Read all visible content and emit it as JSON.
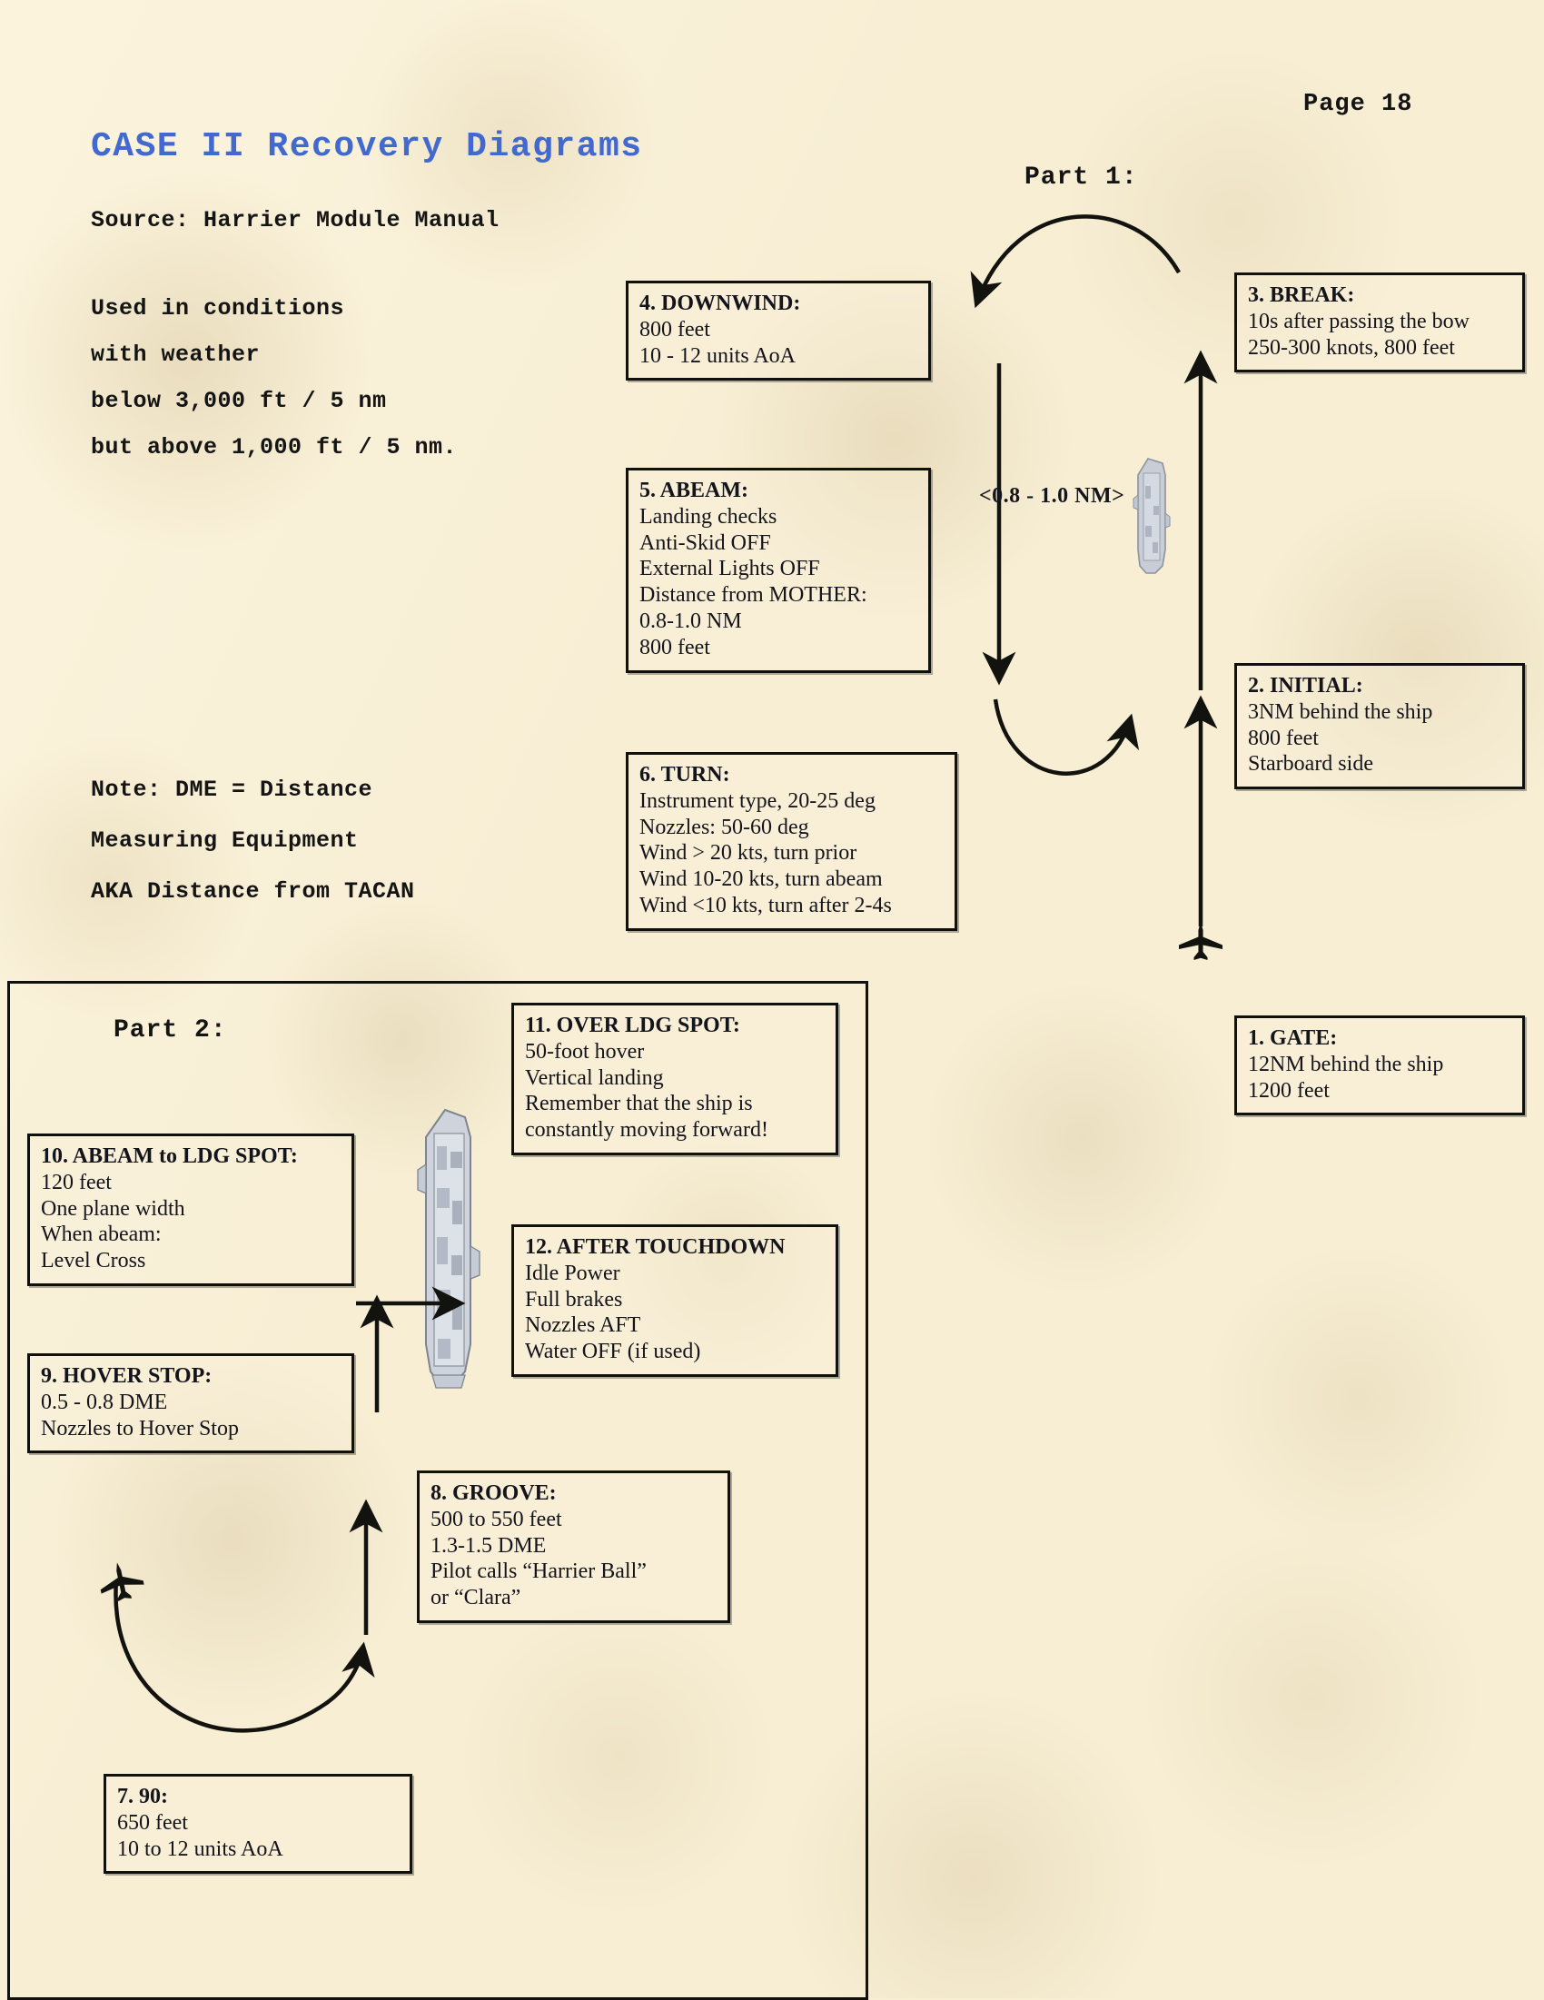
{
  "page": {
    "number_label": "Page 18",
    "title": "CASE II Recovery Diagrams",
    "source": "Source: Harrier Module Manual",
    "accent_color": "#4169cf",
    "background_color": "#f7eed4",
    "border_color": "#10100e"
  },
  "notes": {
    "conditions": [
      "Used in conditions",
      "with weather",
      "below 3,000 ft / 5 nm",
      "but above 1,000 ft / 5 nm."
    ],
    "dme": [
      "Note: DME = Distance",
      "Measuring Equipment",
      "AKA Distance from TACAN"
    ]
  },
  "sections": {
    "part1_label": "Part 1:",
    "part2_label": "Part 2:"
  },
  "annotations": {
    "distance_label": "<0.8 - 1.0 NM>"
  },
  "boxes": [
    {
      "id": "gate",
      "title": "1. GATE:",
      "lines": [
        "12NM behind the ship",
        "1200 feet"
      ]
    },
    {
      "id": "initial",
      "title": "2. INITIAL:",
      "lines": [
        "3NM behind the ship",
        "800 feet",
        "Starboard side"
      ]
    },
    {
      "id": "break",
      "title": "3. BREAK:",
      "lines": [
        "10s after passing the bow",
        "250-300 knots, 800 feet"
      ]
    },
    {
      "id": "downwind",
      "title": "4. DOWNWIND:",
      "lines": [
        "800 feet",
        "10 - 12 units AoA"
      ]
    },
    {
      "id": "abeam",
      "title": "5. ABEAM:",
      "lines": [
        "Landing checks",
        "Anti-Skid OFF",
        "External Lights OFF",
        "Distance from MOTHER:",
        "0.8-1.0 NM",
        "800 feet"
      ]
    },
    {
      "id": "turn",
      "title": "6. TURN:",
      "lines": [
        "Instrument type, 20-25 deg",
        "Nozzles: 50-60 deg",
        "Wind > 20 kts, turn prior",
        "Wind 10-20 kts, turn abeam",
        "Wind <10 kts, turn after 2-4s"
      ]
    },
    {
      "id": "ninety",
      "title": "7. 90:",
      "lines": [
        "650 feet",
        "10 to 12 units AoA"
      ]
    },
    {
      "id": "groove",
      "title": "8. GROOVE:",
      "lines": [
        "500 to 550 feet",
        "1.3-1.5 DME",
        "Pilot calls “Harrier Ball”",
        "or “Clara”"
      ]
    },
    {
      "id": "hover-stop",
      "title": "9. HOVER STOP:",
      "lines": [
        "0.5 - 0.8 DME",
        "Nozzles to Hover Stop"
      ]
    },
    {
      "id": "abeam-ldg-spot",
      "title": "10. ABEAM to LDG SPOT:",
      "lines": [
        "120 feet",
        "One plane width",
        "When abeam:",
        "Level Cross"
      ]
    },
    {
      "id": "over-ldg-spot",
      "title": "11. OVER LDG SPOT:",
      "lines": [
        "50-foot hover",
        "Vertical landing",
        "Remember that the ship is",
        "constantly moving forward!"
      ]
    },
    {
      "id": "after-touchdown",
      "title": "12. AFTER TOUCHDOWN",
      "lines": [
        "Idle Power",
        "Full brakes",
        "Nozzles AFT",
        "Water OFF (if used)"
      ]
    }
  ]
}
